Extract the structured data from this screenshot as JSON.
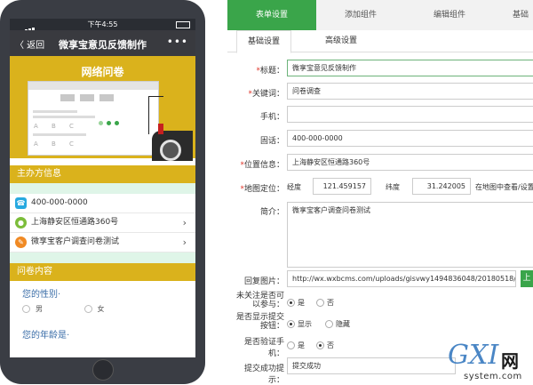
{
  "phone": {
    "status_time": "下午4:55",
    "nav_back": "〈 返回",
    "nav_title": "微享宝意见反馈制作",
    "nav_more": "•••",
    "banner_title": "网络问卷",
    "mock_options": [
      "A",
      "B",
      "C"
    ],
    "organizer_header": "主办方信息",
    "contacts": [
      {
        "icon": "phone-icon",
        "text": "400-000-0000",
        "color": "#27a9e0",
        "chevron": false
      },
      {
        "icon": "location-pin-icon",
        "text": "上海静安区恒通路360号",
        "color": "#7cbd3a",
        "chevron": true
      },
      {
        "icon": "pencil-icon",
        "text": "微享宝客户调查问卷测试",
        "color": "#f08a24",
        "chevron": true
      }
    ],
    "survey_header": "问卷内容",
    "questions": [
      {
        "title": "您的性别·",
        "options": [
          "男",
          "女"
        ]
      },
      {
        "title": "您的年龄是·",
        "options": []
      }
    ]
  },
  "tabs": [
    "表单设置",
    "添加组件",
    "编辑组件",
    "基础"
  ],
  "subtabs": [
    "基础设置",
    "高级设置"
  ],
  "form": {
    "title_label": "标题：",
    "title_value": "微享宝意见反馈制作",
    "keyword_label": "关键词：",
    "keyword_value": "问卷调查",
    "mobile_label": "手机：",
    "mobile_value": "",
    "tel_label": "固话：",
    "tel_value": "400-000-0000",
    "location_label": "位置信息：",
    "location_value": "上海静安区恒通路360号",
    "map_label": "地图定位：",
    "lng_label": "经度",
    "lng_value": "121.459157",
    "lat_label": "纬度",
    "lat_value": "31.242005",
    "map_link": "在地图中查看/设置",
    "intro_label": "简介：",
    "intro_value": "微享宝客户调查问卷测试",
    "image_label": "回复图片：",
    "image_value": "http://wx.wxbcms.com/uploads/gisvwy1494836048/20180518/11",
    "upload_label": "上",
    "unfollow_label": "未关注是否可以参与：",
    "unfollow_options": [
      "是",
      "否"
    ],
    "unfollow_selected": 0,
    "showbtn_label": "是否显示提交按钮：",
    "showbtn_options": [
      "显示",
      "隐藏"
    ],
    "showbtn_selected": 0,
    "verify_label": "是否验证手机：",
    "verify_options": [
      "是",
      "否"
    ],
    "verify_selected": 1,
    "success_label": "提交成功提示：",
    "success_value": "提交成功"
  },
  "watermark": {
    "brand": "GXI",
    "cn": "网",
    "domain": "system.com"
  },
  "colors": {
    "accent": "#3aa54a",
    "banner": "#dab21c",
    "link": "#3b6ea8",
    "required": "#e0382c"
  }
}
